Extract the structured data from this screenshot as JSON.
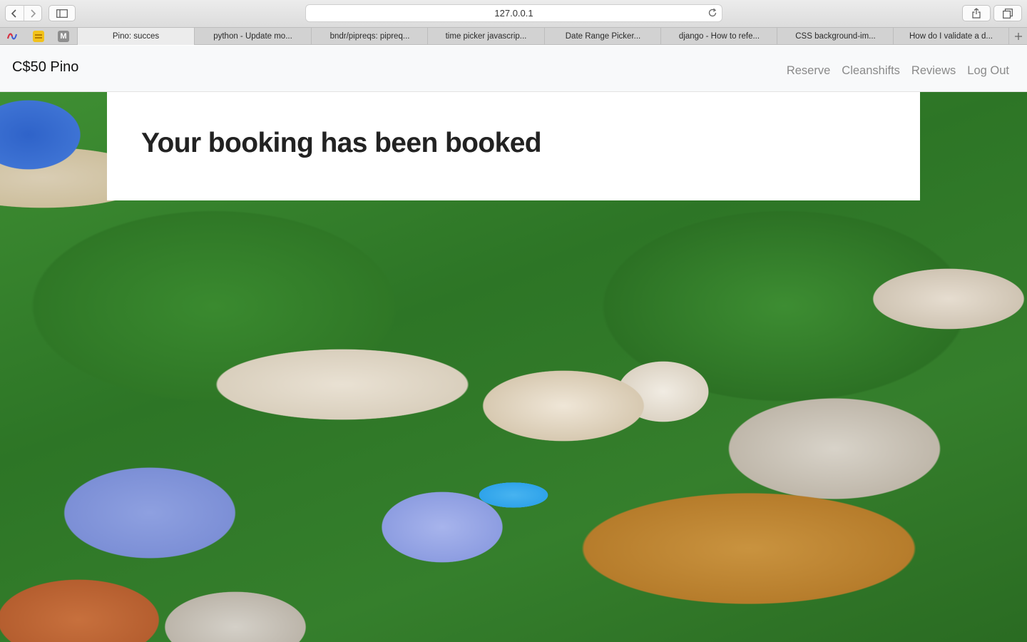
{
  "browser": {
    "url": "127.0.0.1",
    "favicons": [
      "arc-icon",
      "bookmark-icon",
      "m-icon"
    ],
    "favicon_letter": "M",
    "tabs": [
      {
        "label": "Pino: succes",
        "active": true
      },
      {
        "label": "python - Update mo...",
        "active": false
      },
      {
        "label": "bndr/pipreqs: pipreq...",
        "active": false
      },
      {
        "label": "time picker javascrip...",
        "active": false
      },
      {
        "label": "Date Range Picker...",
        "active": false
      },
      {
        "label": "django - How to refe...",
        "active": false
      },
      {
        "label": "CSS background-im...",
        "active": false
      },
      {
        "label": "How do I validate a d...",
        "active": false
      }
    ]
  },
  "navbar": {
    "brand": "C$50 Pino",
    "links": [
      "Reserve",
      "Cleanshifts",
      "Reviews",
      "Log Out"
    ]
  },
  "main": {
    "message": "Your booking has been booked"
  },
  "colors": {
    "navbar_bg": "#f8f9fa",
    "link": "#8a8a8a",
    "heading": "#222222"
  }
}
